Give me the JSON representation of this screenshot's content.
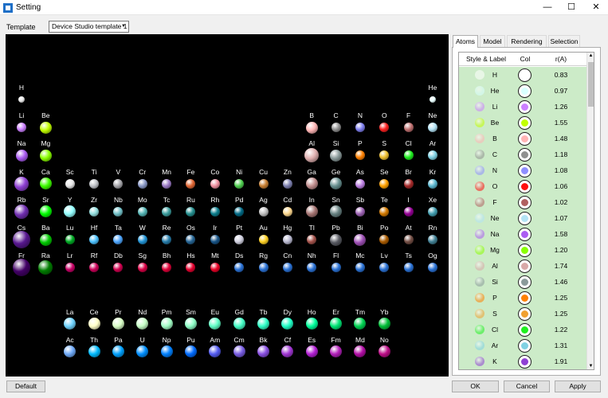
{
  "window": {
    "title": "Setting",
    "minimize_glyph": "—",
    "maximize_glyph": "☐",
    "close_glyph": "✕"
  },
  "template": {
    "label": "Template",
    "value": "Device Studio template 1",
    "arrow_glyph": "▼"
  },
  "tabs": [
    {
      "label": "Atoms",
      "active": true
    },
    {
      "label": "Model"
    },
    {
      "label": "Rendering"
    },
    {
      "label": "Selection"
    }
  ],
  "periodic_table": [
    {
      "symbol": "H",
      "row": 1,
      "col": 1,
      "color": "#e8e8e8",
      "size": 1
    },
    {
      "symbol": "He",
      "row": 1,
      "col": 18,
      "color": "#e8ffff",
      "size": 1
    },
    {
      "symbol": "Li",
      "row": 2,
      "col": 1,
      "color": "#cc80ff",
      "size": 2
    },
    {
      "symbol": "Be",
      "row": 2,
      "col": 2,
      "color": "#c2ff00",
      "size": 3
    },
    {
      "symbol": "B",
      "row": 2,
      "col": 13,
      "color": "#ffb5b5",
      "size": 3
    },
    {
      "symbol": "C",
      "row": 2,
      "col": 14,
      "color": "#909090",
      "size": 2
    },
    {
      "symbol": "N",
      "row": 2,
      "col": 15,
      "color": "#8080f0",
      "size": 2
    },
    {
      "symbol": "O",
      "row": 2,
      "col": 16,
      "color": "#ff2020",
      "size": 2
    },
    {
      "symbol": "F",
      "row": 2,
      "col": 17,
      "color": "#c07070",
      "size": 2
    },
    {
      "symbol": "Ne",
      "row": 2,
      "col": 18,
      "color": "#b3e3f5",
      "size": 2
    },
    {
      "symbol": "Na",
      "row": 3,
      "col": 1,
      "color": "#ab5cf2",
      "size": 3
    },
    {
      "symbol": "Mg",
      "row": 3,
      "col": 2,
      "color": "#8aff00",
      "size": 3
    },
    {
      "symbol": "Al",
      "row": 3,
      "col": 13,
      "color": "#e0b0b0",
      "size": 4
    },
    {
      "symbol": "Si",
      "row": 3,
      "col": 14,
      "color": "#8a9a9a",
      "size": 3
    },
    {
      "symbol": "P",
      "row": 3,
      "col": 15,
      "color": "#ff8000",
      "size": 2
    },
    {
      "symbol": "S",
      "row": 3,
      "col": 16,
      "color": "#f0c030",
      "size": 2
    },
    {
      "symbol": "Cl",
      "row": 3,
      "col": 17,
      "color": "#1ff01f",
      "size": 2
    },
    {
      "symbol": "Ar",
      "row": 3,
      "col": 18,
      "color": "#80d1e3",
      "size": 2
    },
    {
      "symbol": "K",
      "row": 4,
      "col": 1,
      "color": "#8f40d4",
      "size": 4
    },
    {
      "symbol": "Ca",
      "row": 4,
      "col": 2,
      "color": "#3dff00",
      "size": 3
    },
    {
      "symbol": "Sc",
      "row": 4,
      "col": 3,
      "color": "#e6e6e6",
      "size": 2
    },
    {
      "symbol": "Ti",
      "row": 4,
      "col": 4,
      "color": "#bfc2c7",
      "size": 2
    },
    {
      "symbol": "V",
      "row": 4,
      "col": 5,
      "color": "#a6a6ab",
      "size": 2
    },
    {
      "symbol": "Cr",
      "row": 4,
      "col": 6,
      "color": "#8a99c7",
      "size": 2
    },
    {
      "symbol": "Mn",
      "row": 4,
      "col": 7,
      "color": "#9c7ac7",
      "size": 2
    },
    {
      "symbol": "Fe",
      "row": 4,
      "col": 8,
      "color": "#e06633",
      "size": 2
    },
    {
      "symbol": "Co",
      "row": 4,
      "col": 9,
      "color": "#f090a0",
      "size": 2
    },
    {
      "symbol": "Ni",
      "row": 4,
      "col": 10,
      "color": "#50d050",
      "size": 2
    },
    {
      "symbol": "Cu",
      "row": 4,
      "col": 11,
      "color": "#c88033",
      "size": 2
    },
    {
      "symbol": "Zn",
      "row": 4,
      "col": 12,
      "color": "#7d80b0",
      "size": 2
    },
    {
      "symbol": "Ga",
      "row": 4,
      "col": 13,
      "color": "#c28f8f",
      "size": 3
    },
    {
      "symbol": "Ge",
      "row": 4,
      "col": 14,
      "color": "#668f8f",
      "size": 3
    },
    {
      "symbol": "As",
      "row": 4,
      "col": 15,
      "color": "#bd80e3",
      "size": 2
    },
    {
      "symbol": "Se",
      "row": 4,
      "col": 16,
      "color": "#ffa100",
      "size": 2
    },
    {
      "symbol": "Br",
      "row": 4,
      "col": 17,
      "color": "#a62929",
      "size": 2
    },
    {
      "symbol": "Kr",
      "row": 4,
      "col": 18,
      "color": "#5cb8d1",
      "size": 2
    },
    {
      "symbol": "Rb",
      "row": 5,
      "col": 1,
      "color": "#702eb0",
      "size": 4
    },
    {
      "symbol": "Sr",
      "row": 5,
      "col": 2,
      "color": "#00ff00",
      "size": 3
    },
    {
      "symbol": "Y",
      "row": 5,
      "col": 3,
      "color": "#94ffff",
      "size": 3
    },
    {
      "symbol": "Zr",
      "row": 5,
      "col": 4,
      "color": "#94e0e0",
      "size": 2
    },
    {
      "symbol": "Nb",
      "row": 5,
      "col": 5,
      "color": "#73c2c9",
      "size": 2
    },
    {
      "symbol": "Mo",
      "row": 5,
      "col": 6,
      "color": "#54b5b5",
      "size": 2
    },
    {
      "symbol": "Tc",
      "row": 5,
      "col": 7,
      "color": "#3b9e9e",
      "size": 2
    },
    {
      "symbol": "Ru",
      "row": 5,
      "col": 8,
      "color": "#248f8f",
      "size": 2
    },
    {
      "symbol": "Rh",
      "row": 5,
      "col": 9,
      "color": "#0a7d8c",
      "size": 2
    },
    {
      "symbol": "Pd",
      "row": 5,
      "col": 10,
      "color": "#006985",
      "size": 2
    },
    {
      "symbol": "Ag",
      "row": 5,
      "col": 11,
      "color": "#c0c0c0",
      "size": 2
    },
    {
      "symbol": "Cd",
      "row": 5,
      "col": 12,
      "color": "#ffd98f",
      "size": 2
    },
    {
      "symbol": "In",
      "row": 5,
      "col": 13,
      "color": "#a67573",
      "size": 3
    },
    {
      "symbol": "Sn",
      "row": 5,
      "col": 14,
      "color": "#668080",
      "size": 3
    },
    {
      "symbol": "Sb",
      "row": 5,
      "col": 15,
      "color": "#9e63b5",
      "size": 2
    },
    {
      "symbol": "Te",
      "row": 5,
      "col": 16,
      "color": "#d47a00",
      "size": 2
    },
    {
      "symbol": "I",
      "row": 5,
      "col": 17,
      "color": "#940094",
      "size": 2
    },
    {
      "symbol": "Xe",
      "row": 5,
      "col": 18,
      "color": "#429eb0",
      "size": 2
    },
    {
      "symbol": "Cs",
      "row": 6,
      "col": 1,
      "color": "#57178f",
      "size": 5
    },
    {
      "symbol": "Ba",
      "row": 6,
      "col": 2,
      "color": "#00c900",
      "size": 3
    },
    {
      "symbol": "Lu",
      "row": 6,
      "col": 3,
      "color": "#00ab24",
      "size": 2
    },
    {
      "symbol": "Hf",
      "row": 6,
      "col": 4,
      "color": "#4dc2ff",
      "size": 2
    },
    {
      "symbol": "Ta",
      "row": 6,
      "col": 5,
      "color": "#4da6ff",
      "size": 2
    },
    {
      "symbol": "W",
      "row": 6,
      "col": 6,
      "color": "#2194d6",
      "size": 2
    },
    {
      "symbol": "Re",
      "row": 6,
      "col": 7,
      "color": "#267dab",
      "size": 2
    },
    {
      "symbol": "Os",
      "row": 6,
      "col": 8,
      "color": "#266696",
      "size": 2
    },
    {
      "symbol": "Ir",
      "row": 6,
      "col": 9,
      "color": "#175487",
      "size": 2
    },
    {
      "symbol": "Pt",
      "row": 6,
      "col": 10,
      "color": "#d0d0e0",
      "size": 2
    },
    {
      "symbol": "Au",
      "row": 6,
      "col": 11,
      "color": "#ffd123",
      "size": 2
    },
    {
      "symbol": "Hg",
      "row": 6,
      "col": 12,
      "color": "#b8b8d0",
      "size": 2
    },
    {
      "symbol": "Tl",
      "row": 6,
      "col": 13,
      "color": "#a6544d",
      "size": 2
    },
    {
      "symbol": "Pb",
      "row": 6,
      "col": 14,
      "color": "#575961",
      "size": 3
    },
    {
      "symbol": "Bi",
      "row": 6,
      "col": 15,
      "color": "#9e4fb5",
      "size": 3
    },
    {
      "symbol": "Po",
      "row": 6,
      "col": 16,
      "color": "#ab5c00",
      "size": 2
    },
    {
      "symbol": "At",
      "row": 6,
      "col": 17,
      "color": "#754f45",
      "size": 2
    },
    {
      "symbol": "Rn",
      "row": 6,
      "col": 18,
      "color": "#428296",
      "size": 2
    },
    {
      "symbol": "Fr",
      "row": 7,
      "col": 1,
      "color": "#420066",
      "size": 5
    },
    {
      "symbol": "Ra",
      "row": 7,
      "col": 2,
      "color": "#007d00",
      "size": 4
    },
    {
      "symbol": "Lr",
      "row": 7,
      "col": 3,
      "color": "#c70066",
      "size": 2
    },
    {
      "symbol": "Rf",
      "row": 7,
      "col": 4,
      "color": "#cc0059",
      "size": 2
    },
    {
      "symbol": "Db",
      "row": 7,
      "col": 5,
      "color": "#d1004f",
      "size": 2
    },
    {
      "symbol": "Sg",
      "row": 7,
      "col": 6,
      "color": "#d90045",
      "size": 2
    },
    {
      "symbol": "Bh",
      "row": 7,
      "col": 7,
      "color": "#e00038",
      "size": 2
    },
    {
      "symbol": "Hs",
      "row": 7,
      "col": 8,
      "color": "#e6002e",
      "size": 2
    },
    {
      "symbol": "Mt",
      "row": 7,
      "col": 9,
      "color": "#eb0026",
      "size": 2
    },
    {
      "symbol": "Ds",
      "row": 7,
      "col": 10,
      "color": "#2a72d6",
      "size": 2
    },
    {
      "symbol": "Rg",
      "row": 7,
      "col": 11,
      "color": "#2a72d6",
      "size": 2
    },
    {
      "symbol": "Cn",
      "row": 7,
      "col": 12,
      "color": "#2a72d6",
      "size": 2
    },
    {
      "symbol": "Nh",
      "row": 7,
      "col": 13,
      "color": "#2a72d6",
      "size": 2
    },
    {
      "symbol": "Fl",
      "row": 7,
      "col": 14,
      "color": "#2a72d6",
      "size": 2
    },
    {
      "symbol": "Mc",
      "row": 7,
      "col": 15,
      "color": "#2a72d6",
      "size": 2
    },
    {
      "symbol": "Lv",
      "row": 7,
      "col": 16,
      "color": "#2a72d6",
      "size": 2
    },
    {
      "symbol": "Ts",
      "row": 7,
      "col": 17,
      "color": "#2a72d6",
      "size": 2
    },
    {
      "symbol": "Og",
      "row": 7,
      "col": 18,
      "color": "#2a72d6",
      "size": 2
    },
    {
      "symbol": "La",
      "row": 9,
      "col": 3,
      "color": "#70d4ff",
      "size": 3
    },
    {
      "symbol": "Ce",
      "row": 9,
      "col": 4,
      "color": "#ffffc7",
      "size": 3
    },
    {
      "symbol": "Pr",
      "row": 9,
      "col": 5,
      "color": "#d9ffc7",
      "size": 3
    },
    {
      "symbol": "Nd",
      "row": 9,
      "col": 6,
      "color": "#c7ffc7",
      "size": 3
    },
    {
      "symbol": "Pm",
      "row": 9,
      "col": 7,
      "color": "#a3ffc7",
      "size": 3
    },
    {
      "symbol": "Sm",
      "row": 9,
      "col": 8,
      "color": "#8fffc7",
      "size": 3
    },
    {
      "symbol": "Eu",
      "row": 9,
      "col": 9,
      "color": "#61ffc7",
      "size": 3
    },
    {
      "symbol": "Gd",
      "row": 9,
      "col": 10,
      "color": "#45ffc7",
      "size": 3
    },
    {
      "symbol": "Tb",
      "row": 9,
      "col": 11,
      "color": "#30ffc7",
      "size": 3
    },
    {
      "symbol": "Dy",
      "row": 9,
      "col": 12,
      "color": "#1fffc7",
      "size": 3
    },
    {
      "symbol": "Ho",
      "row": 9,
      "col": 13,
      "color": "#00ff9c",
      "size": 3
    },
    {
      "symbol": "Er",
      "row": 9,
      "col": 14,
      "color": "#00e675",
      "size": 3
    },
    {
      "symbol": "Tm",
      "row": 9,
      "col": 15,
      "color": "#00d452",
      "size": 3
    },
    {
      "symbol": "Yb",
      "row": 9,
      "col": 16,
      "color": "#00bf38",
      "size": 3
    },
    {
      "symbol": "Ac",
      "row": 10,
      "col": 3,
      "color": "#70abfa",
      "size": 3
    },
    {
      "symbol": "Th",
      "row": 10,
      "col": 4,
      "color": "#00baff",
      "size": 3
    },
    {
      "symbol": "Pa",
      "row": 10,
      "col": 5,
      "color": "#00a1ff",
      "size": 3
    },
    {
      "symbol": "U",
      "row": 10,
      "col": 6,
      "color": "#008fff",
      "size": 3
    },
    {
      "symbol": "Np",
      "row": 10,
      "col": 7,
      "color": "#0080ff",
      "size": 3
    },
    {
      "symbol": "Pu",
      "row": 10,
      "col": 8,
      "color": "#006bff",
      "size": 3
    },
    {
      "symbol": "Am",
      "row": 10,
      "col": 9,
      "color": "#545cf2",
      "size": 3
    },
    {
      "symbol": "Cm",
      "row": 10,
      "col": 10,
      "color": "#785ce3",
      "size": 3
    },
    {
      "symbol": "Bk",
      "row": 10,
      "col": 11,
      "color": "#8a4fe3",
      "size": 3
    },
    {
      "symbol": "Cf",
      "row": 10,
      "col": 12,
      "color": "#a136d4",
      "size": 3
    },
    {
      "symbol": "Es",
      "row": 10,
      "col": 13,
      "color": "#b31fd4",
      "size": 3
    },
    {
      "symbol": "Fm",
      "row": 10,
      "col": 14,
      "color": "#b31fba",
      "size": 3
    },
    {
      "symbol": "Md",
      "row": 10,
      "col": 15,
      "color": "#b30da6",
      "size": 3
    },
    {
      "symbol": "No",
      "row": 10,
      "col": 16,
      "color": "#bd0d87",
      "size": 3
    }
  ],
  "atom_table": {
    "headers": [
      "Style & Label",
      "Col",
      "r(A)"
    ],
    "rows": [
      {
        "symbol": "H",
        "color": "#ffffff",
        "radius": "0.83"
      },
      {
        "symbol": "He",
        "color": "#d9ffff",
        "radius": "0.97"
      },
      {
        "symbol": "Li",
        "color": "#cc80ff",
        "radius": "1.26"
      },
      {
        "symbol": "Be",
        "color": "#c2ff00",
        "radius": "1.55"
      },
      {
        "symbol": "B",
        "color": "#ffb5b5",
        "radius": "1.48"
      },
      {
        "symbol": "C",
        "color": "#909090",
        "radius": "1.18"
      },
      {
        "symbol": "N",
        "color": "#8f8fff",
        "radius": "1.08"
      },
      {
        "symbol": "O",
        "color": "#ff0d0d",
        "radius": "1.06"
      },
      {
        "symbol": "F",
        "color": "#b06060",
        "radius": "1.02"
      },
      {
        "symbol": "Ne",
        "color": "#b3e3f5",
        "radius": "1.07"
      },
      {
        "symbol": "Na",
        "color": "#ab5cf2",
        "radius": "1.58"
      },
      {
        "symbol": "Mg",
        "color": "#8aff00",
        "radius": "1.20"
      },
      {
        "symbol": "Al",
        "color": "#d9a8a8",
        "radius": "1.74"
      },
      {
        "symbol": "Si",
        "color": "#8a9a9a",
        "radius": "1.46"
      },
      {
        "symbol": "P",
        "color": "#ff8000",
        "radius": "1.25"
      },
      {
        "symbol": "S",
        "color": "#f0a030",
        "radius": "1.25"
      },
      {
        "symbol": "Cl",
        "color": "#1ff01f",
        "radius": "1.22"
      },
      {
        "symbol": "Ar",
        "color": "#80d1e3",
        "radius": "1.31"
      },
      {
        "symbol": "K",
        "color": "#8f40d4",
        "radius": "1.91"
      }
    ]
  },
  "scrollbar": {
    "up_glyph": "▲",
    "down_glyph": "▼"
  },
  "buttons": {
    "default": "Default",
    "ok": "OK",
    "cancel": "Cancel",
    "apply": "Apply"
  }
}
